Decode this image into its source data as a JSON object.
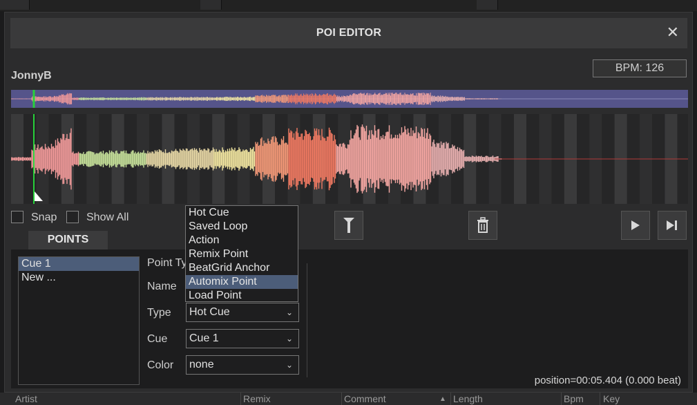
{
  "background_app": {
    "columns": [
      "Artist",
      "Remix",
      "Comment",
      "Length",
      "Bpm",
      "Key"
    ]
  },
  "dialog": {
    "title": "POI EDITOR",
    "close_icon": "close-icon"
  },
  "track": {
    "name": "JonnyB",
    "bpm": "BPM: 126"
  },
  "controls": {
    "snap_label": "Snap",
    "show_all_label": "Show All",
    "marker_icon": "marker-icon",
    "delete_icon": "trash-icon",
    "play_icon": "play-icon",
    "next_icon": "skip-next-icon"
  },
  "tabs": {
    "points": "POINTS"
  },
  "points": {
    "items": [
      "Cue 1",
      "New ..."
    ],
    "selected": "Cue 1"
  },
  "form": {
    "point_type_label": "Point Ty",
    "name_label": "Name",
    "type_label": "Type",
    "type_value": "Hot Cue",
    "cue_label": "Cue",
    "cue_value": "Cue 1",
    "color_label": "Color",
    "color_value": "none"
  },
  "dropdown": {
    "options": [
      "Hot Cue",
      "Saved Loop",
      "Action",
      "Remix Point",
      "BeatGrid Anchor",
      "Automix Point",
      "Load Point"
    ],
    "highlighted": "Automix Point"
  },
  "status": {
    "position": "position=00:05.404 (0.000 beat)"
  },
  "colors": {
    "selection": "#4c5d79",
    "overview_bg": "#55548a",
    "cue_marker": "#27d13a"
  }
}
